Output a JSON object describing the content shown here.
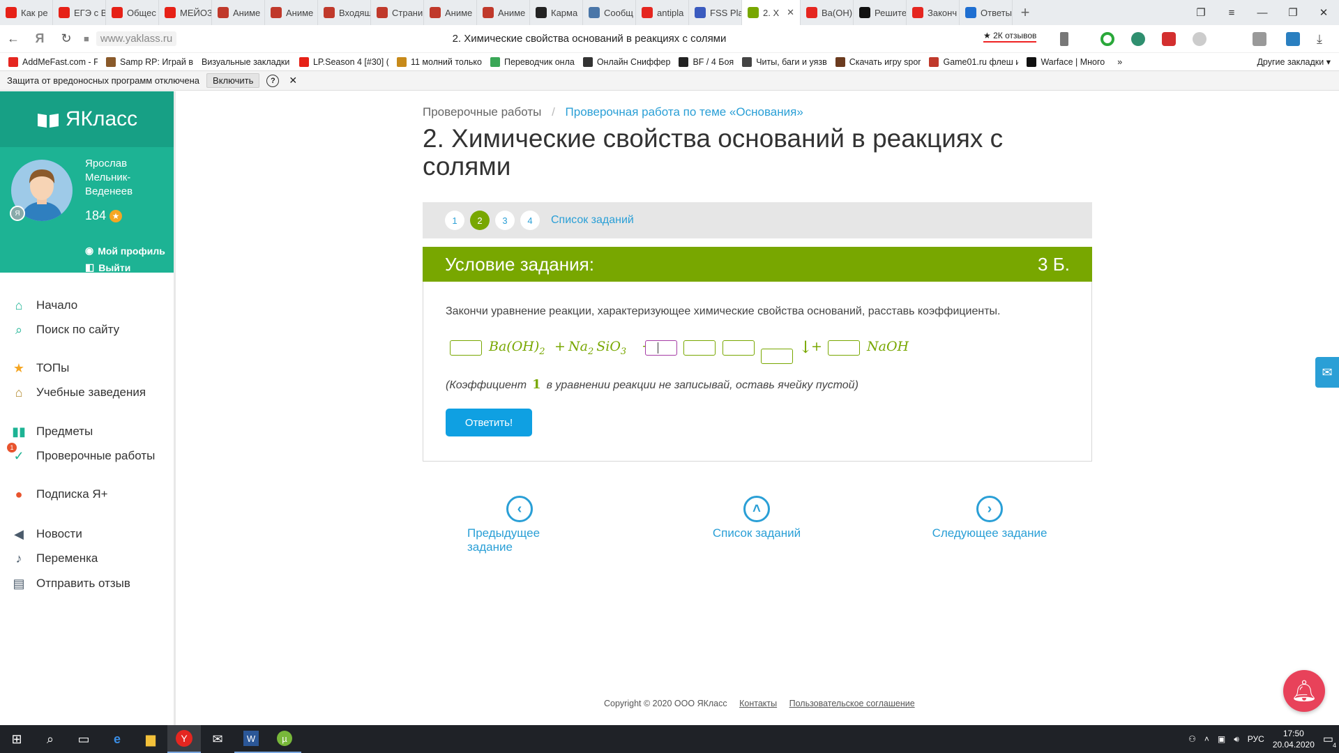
{
  "browser": {
    "tabs": [
      {
        "label": "Как ре",
        "icon": "youtube-icon",
        "color": "#e62117"
      },
      {
        "label": "ЕГЭ с В",
        "icon": "youtube-icon",
        "color": "#e62117"
      },
      {
        "label": "Общес",
        "icon": "youtube-icon",
        "color": "#e62117"
      },
      {
        "label": "МЕЙОЗ",
        "icon": "youtube-icon",
        "color": "#e62117"
      },
      {
        "label": "Аниме",
        "icon": "anime-site-icon",
        "color": "#c0392b"
      },
      {
        "label": "Аниме",
        "icon": "anime-site-icon",
        "color": "#c0392b"
      },
      {
        "label": "Входящ",
        "icon": "anime-site-icon",
        "color": "#c0392b"
      },
      {
        "label": "Страни",
        "icon": "anime-site-icon",
        "color": "#c0392b"
      },
      {
        "label": "Аниме",
        "icon": "anime-site-icon",
        "color": "#c0392b"
      },
      {
        "label": "Аниме",
        "icon": "anime-site-icon",
        "color": "#c0392b"
      },
      {
        "label": "Карма",
        "icon": "plus-square-icon",
        "color": "#222222"
      },
      {
        "label": "Сообщ",
        "icon": "vk-icon",
        "color": "#4a76a8"
      },
      {
        "label": "antipla",
        "icon": "yandex-icon",
        "color": "#e52620"
      },
      {
        "label": "FSS Pla",
        "icon": "fss-icon",
        "color": "#3a5bbf"
      },
      {
        "label": "2. Х",
        "icon": "yaklass-icon",
        "color": "#78a700",
        "active": true
      },
      {
        "label": "Ba(OH)",
        "icon": "yandex-icon",
        "color": "#e52620"
      },
      {
        "label": "Решите",
        "icon": "z-icon",
        "color": "#111111"
      },
      {
        "label": "Законч",
        "icon": "yandex-icon",
        "color": "#e52620"
      },
      {
        "label": "Ответы",
        "icon": "answers-icon",
        "color": "#1f6fd1"
      }
    ],
    "url": "www.yaklass.ru",
    "page_title": "2. Химические свойства оснований в реакциях с солями",
    "reviews": "★ 2К отзывов",
    "bookmarks": [
      {
        "label": "AddMeFast.com - F",
        "color": "#e52620"
      },
      {
        "label": "Samp RP: Играй в",
        "color": "#8a5a2b"
      },
      {
        "label": "Визуальные закладки ▾",
        "color": ""
      },
      {
        "label": "LP.Season 4 [#30] (",
        "color": "#e62117"
      },
      {
        "label": "11 молний только",
        "color": "#c78a1a"
      },
      {
        "label": "Переводчик онла",
        "color": "#3aa757"
      },
      {
        "label": "Онлайн Сниффер",
        "color": "#333333"
      },
      {
        "label": "BF / 4 Боя",
        "color": "#222222"
      },
      {
        "label": "Читы, баги и уязв",
        "color": "#444444"
      },
      {
        "label": "Скачать игру spor",
        "color": "#6b3b1f"
      },
      {
        "label": "Game01.ru флеш и",
        "color": "#c0392b"
      },
      {
        "label": "Warface | Много",
        "color": "#111111"
      }
    ],
    "bookmarks_more": "»",
    "other_bookmarks": "Другие закладки ▾"
  },
  "protection": {
    "text": "Защита от вредоносных программ отключена",
    "enable": "Включить",
    "help": "?",
    "close": "✕"
  },
  "sidebar": {
    "logo": "ЯКласс",
    "user_name": "Ярослав Мельник-Веденеев",
    "score": "184",
    "profile": "Мой профиль",
    "logout": "Выйти",
    "items": [
      {
        "label": "Начало",
        "icon": "home-icon",
        "glyph": "⌂",
        "color": "#1db394"
      },
      {
        "label": "Поиск по сайту",
        "icon": "search-icon",
        "glyph": "⌕",
        "color": "#1db394"
      },
      {
        "label": "ТОПы",
        "icon": "star-icon",
        "glyph": "★",
        "color": "#f5a623"
      },
      {
        "label": "Учебные заведения",
        "icon": "institution-icon",
        "glyph": "⌂",
        "color": "#b38a2e"
      },
      {
        "label": "Предметы",
        "icon": "books-icon",
        "glyph": "▮▮",
        "color": "#1db394"
      },
      {
        "label": "Проверочные работы",
        "icon": "check-icon",
        "glyph": "✓",
        "color": "#1db394",
        "badge": "1"
      },
      {
        "label": "Подписка Я+",
        "icon": "subscription-icon",
        "glyph": "●",
        "color": "#e8542e"
      },
      {
        "label": "Новости",
        "icon": "megaphone-icon",
        "glyph": "◀",
        "color": "#4b5b6b"
      },
      {
        "label": "Переменка",
        "icon": "bell-icon",
        "glyph": "♪",
        "color": "#4b5b6b"
      },
      {
        "label": "Отправить отзыв",
        "icon": "feedback-icon",
        "glyph": "▤",
        "color": "#4b5b6b"
      }
    ]
  },
  "main": {
    "breadcrumb_1": "Проверочные работы",
    "breadcrumb_sep": "/",
    "breadcrumb_2": "Проверочная работа по теме «Основания»",
    "title": "2. Химические свойства оснований в реакциях с солями",
    "task_numbers": [
      "1",
      "2",
      "3",
      "4"
    ],
    "current_task": "2",
    "task_list": "Список заданий",
    "condition_title": "Условие задания:",
    "points": "3 Б.",
    "instruction": "Закончи уравнение реакции, характеризующее химические свойства оснований, расставь коэффициенты.",
    "equation": {
      "reactant1": "Ba(OH)",
      "reactant1_sub": "2",
      "plus1": "+",
      "reactant2_a": "Na",
      "reactant2_sub": "2",
      "reactant2_b": "SiO",
      "reactant2_sub2": "3",
      "arrow": "→",
      "precipitate": "↓",
      "plus2": "+",
      "product": "NaOH"
    },
    "note_before": "(Коэффициент",
    "note_one": "1",
    "note_after": "в уравнении реакции не записывай, оставь ячейку пустой)",
    "answer_button": "Ответить!",
    "prev_task": "Предыдущее задание",
    "task_list_bottom": "Список заданий",
    "next_task": "Следующее задание"
  },
  "footer": {
    "copyright": "Copyright © 2020 ООО ЯКласс",
    "contacts": "Контакты",
    "agreement": "Пользовательское соглашение"
  },
  "os": {
    "lang": "РУС",
    "time": "17:50",
    "date": "20.04.2020",
    "notifications": "4"
  }
}
